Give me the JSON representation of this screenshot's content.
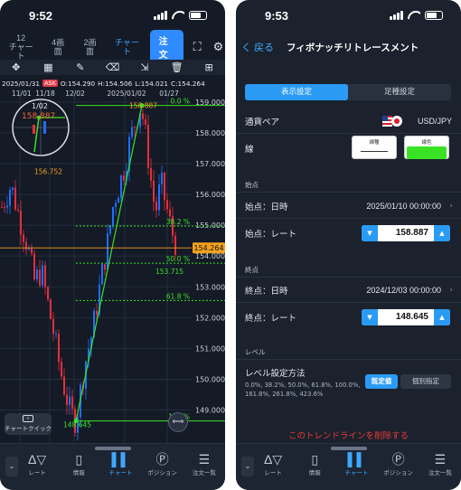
{
  "left": {
    "status_time": "9:52",
    "tabs": [
      {
        "label": "12\nチャート"
      },
      {
        "label": "4画面"
      },
      {
        "label": "2画面"
      },
      {
        "label": "チャート"
      }
    ],
    "order_button": "注文",
    "ohlc": {
      "date": "2025/01/31",
      "ask": "ASK",
      "open": "O:154.290",
      "high": "H:154.506",
      "low": "L:154.021",
      "close": "C:154.264"
    },
    "chart_data": {
      "type": "candlestick",
      "x_labels": [
        "11/01",
        "11/18",
        "12/02",
        "2025/01/02",
        "01/27"
      ],
      "y_ticks": [
        "159.000",
        "158.000",
        "157.000",
        "156.000",
        "155.000",
        "154.000",
        "153.000",
        "152.000",
        "151.000",
        "150.000",
        "149.000"
      ],
      "ylim": [
        148.4,
        159.2
      ],
      "current_price": "154.264",
      "crosshair_date": "1/02",
      "crosshair_price": "158.887",
      "marker_labels": [
        "156.752",
        "158.887",
        "148.645",
        "153.715"
      ],
      "fib_levels": [
        {
          "label": "0.0 %",
          "price": 158.887
        },
        {
          "label": "38.2 %",
          "price": 154.974
        },
        {
          "label": "50.0 %",
          "price": 153.766
        },
        {
          "label": "61.8 %",
          "price": 152.557
        },
        {
          "label": "100 %",
          "price": 148.645
        }
      ],
      "trend_start": {
        "price": 158.887
      },
      "trend_end": {
        "price": 148.645
      },
      "colors": {
        "up": "#1f6fff",
        "down": "#e62e3c",
        "fib": "#39e324",
        "price_tag": "#f2a21d"
      }
    },
    "chart_quick": "チャートクイック",
    "bottom_nav": [
      {
        "label": "レート",
        "icon": "Δ▽"
      },
      {
        "label": "情報",
        "icon": "▯"
      },
      {
        "label": "チャート",
        "icon": "▌▌"
      },
      {
        "label": "ポジション",
        "icon": "Ⓟ"
      },
      {
        "label": "注文一覧",
        "icon": "☰"
      }
    ]
  },
  "right": {
    "status_time": "9:53",
    "back": "く 戻る",
    "title": "フィボナッチリトレースメント",
    "segments": [
      "表示設定",
      "足種設定"
    ],
    "pair_label": "通貨ペア",
    "pair_value": "USD/JPY",
    "line_label": "線",
    "line_kind": "線種",
    "line_color": "線色",
    "start_section": "始点",
    "start_date_label": "始点：日時",
    "start_date_value": "2025/01/10 00:00:00",
    "start_rate_label": "始点：レート",
    "start_rate_value": "158.887",
    "end_section": "終点",
    "end_date_label": "終点：日時",
    "end_date_value": "2024/12/03 00:00:00",
    "end_rate_label": "終点：レート",
    "end_rate_value": "148.645",
    "level_section": "レベル",
    "level_method_label": "レベル設定方法",
    "level_values": "0.0%, 38.2%, 50.0%, 61.8%, 100.0%,\n161.8%, 261.8%, 423.6%",
    "level_default": "既定値",
    "level_custom": "個別指定",
    "delete_text": "このトレンドラインを削除する",
    "bottom_nav": [
      {
        "label": "レート",
        "icon": "Δ▽"
      },
      {
        "label": "情報",
        "icon": "▯"
      },
      {
        "label": "チャート",
        "icon": "▌▌"
      },
      {
        "label": "ポジション",
        "icon": "Ⓟ"
      },
      {
        "label": "注文一覧",
        "icon": "☰"
      }
    ]
  }
}
